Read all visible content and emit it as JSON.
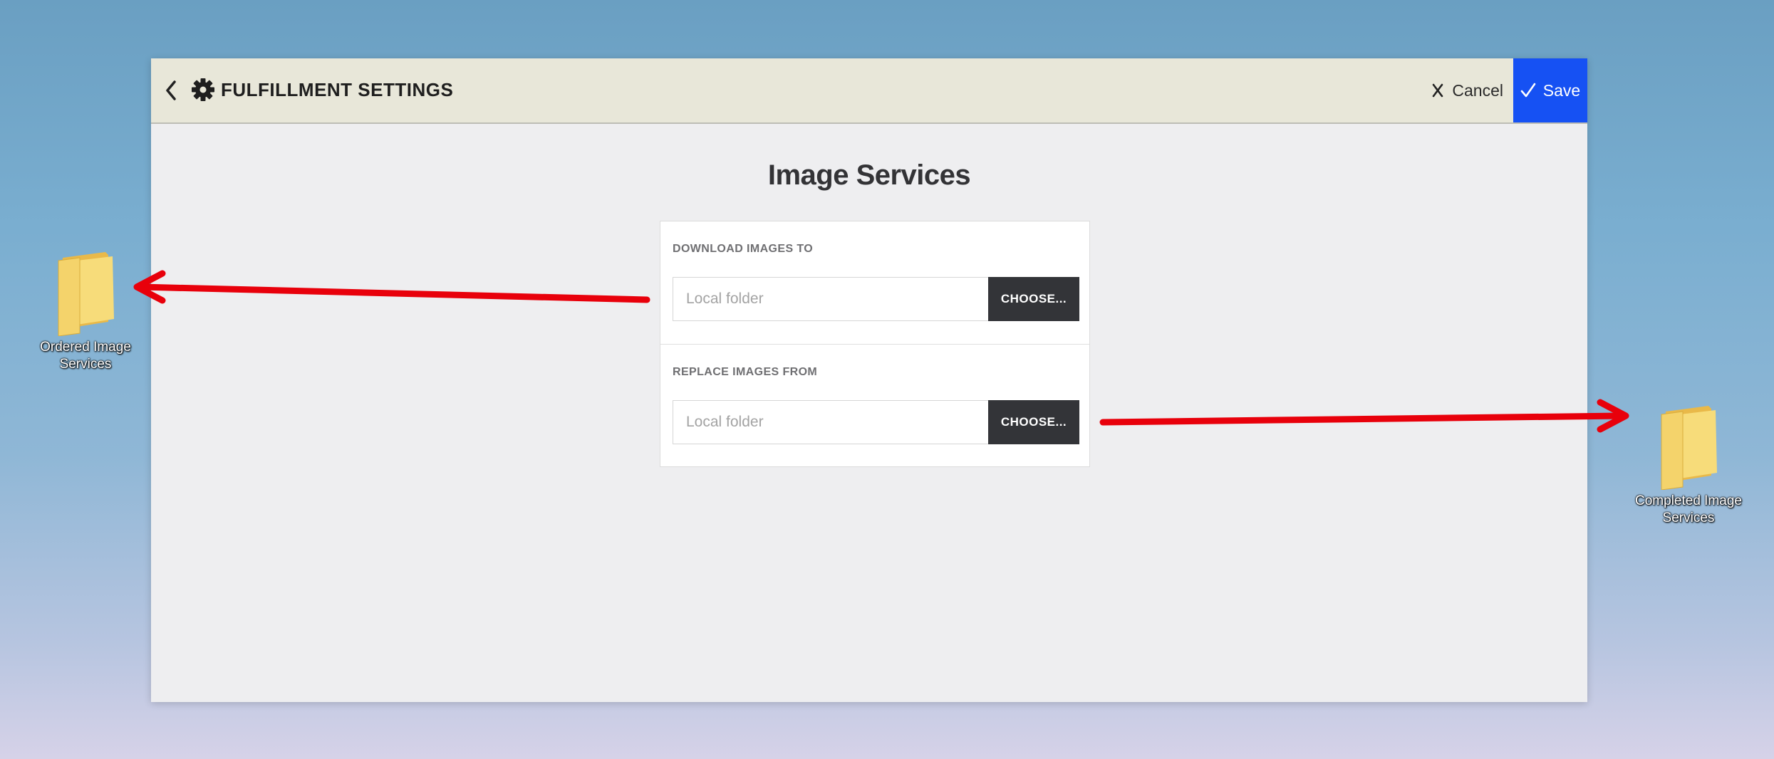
{
  "desktop": {
    "icons": [
      {
        "label": "Ordered Image Services"
      },
      {
        "label": "Completed Image Services"
      }
    ]
  },
  "header": {
    "title": "FULFILLMENT SETTINGS",
    "cancel_label": "Cancel",
    "save_label": "Save"
  },
  "main": {
    "title": "Image Services",
    "rows": [
      {
        "label": "DOWNLOAD IMAGES TO",
        "value": "",
        "placeholder": "Local folder",
        "button_label": "CHOOSE..."
      },
      {
        "label": "REPLACE IMAGES FROM",
        "value": "",
        "placeholder": "Local folder",
        "button_label": "CHOOSE..."
      }
    ]
  },
  "icons": {
    "back": "chevron-left-icon",
    "settings": "gear-icon",
    "cancel": "close-icon",
    "save": "check-icon",
    "desktop_folder": "folder-icon"
  },
  "colors": {
    "save_button": "#1651f3",
    "header_bg": "#e8e7d9",
    "choose_button": "#333438",
    "annotation_arrow": "#e8000b",
    "folder": "#f6d66a"
  }
}
